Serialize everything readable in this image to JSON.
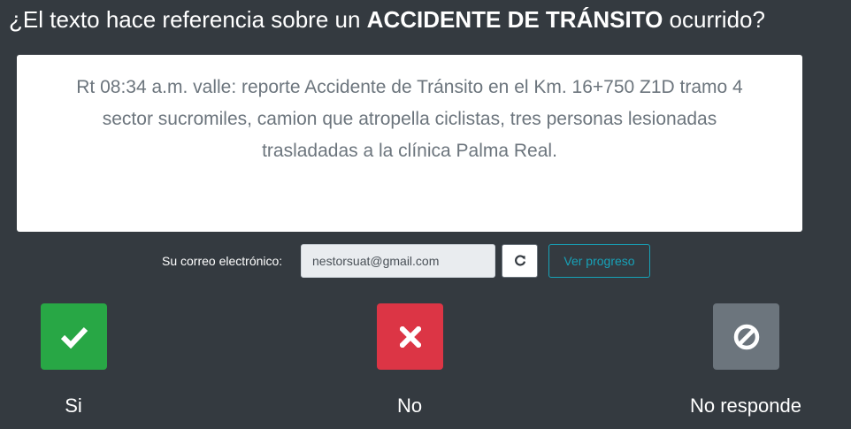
{
  "question": {
    "prefix": "¿El texto hace referencia sobre un ",
    "emphasis": "ACCIDENTE DE TRÁNSITO",
    "suffix": " ocurrido?"
  },
  "report_text": "Rt 08:34 a.m. valle: reporte Accidente de Tránsito en el Km. 16+750 Z1D tramo 4 sector sucromiles, camion que atropella ciclistas, tres personas lesionadas trasladadas a la clínica Palma Real.",
  "email": {
    "label": "Su correo electrónico:",
    "value": "nestorsuat@gmail.com",
    "refresh_icon": "refresh-icon",
    "progress_label": "Ver progreso"
  },
  "answers": {
    "yes": {
      "label": "Si",
      "icon": "check-icon",
      "color": "#28a745"
    },
    "no": {
      "label": "No",
      "icon": "x-icon",
      "color": "#dc3545"
    },
    "no_answer": {
      "label": "No responde",
      "icon": "ban-icon",
      "color": "#6c757d"
    }
  },
  "colors": {
    "background": "#343a40",
    "accent": "#17a2b8"
  }
}
